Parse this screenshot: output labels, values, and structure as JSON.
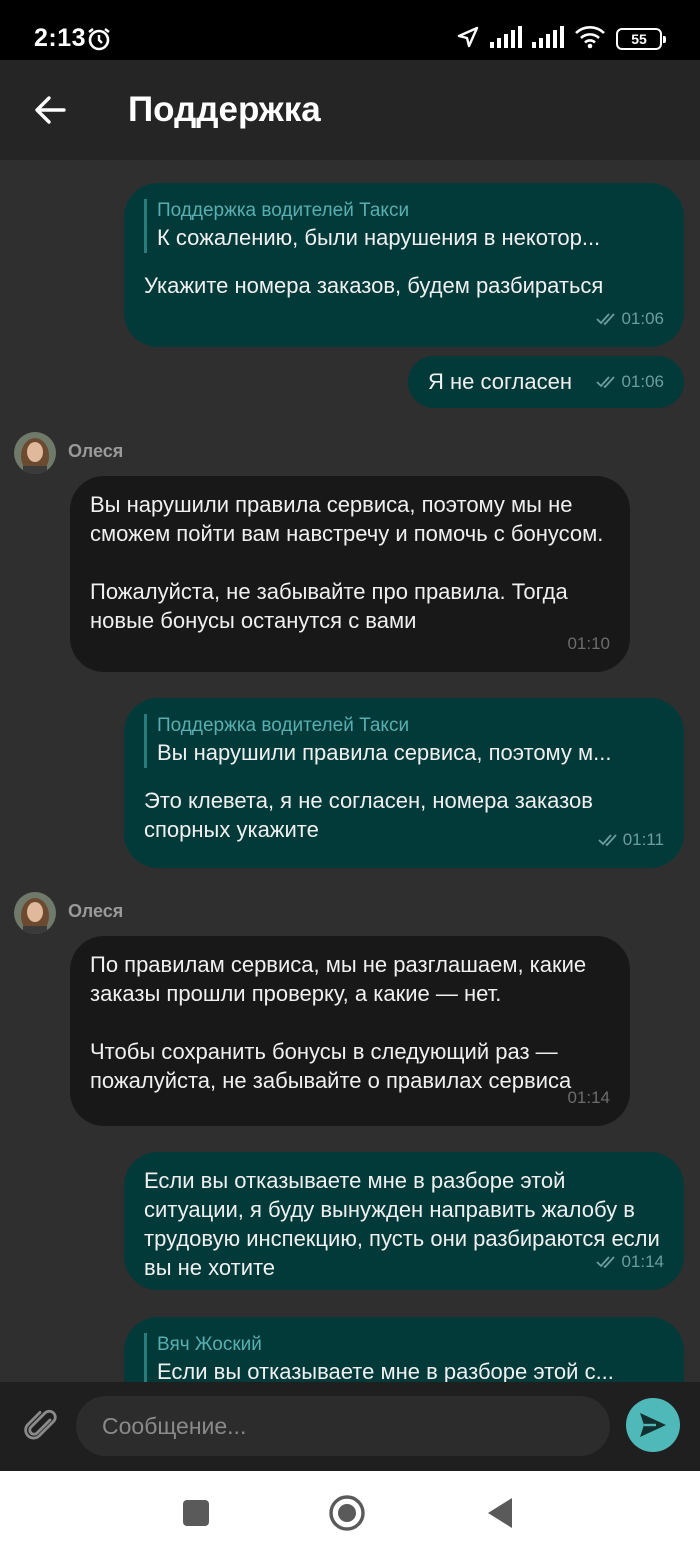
{
  "status_bar": {
    "time": "2:13",
    "battery": "55",
    "icons": [
      "alarm-icon",
      "location-icon",
      "signal-icon",
      "signal-icon",
      "wifi-icon",
      "battery-icon"
    ]
  },
  "header": {
    "title": "Поддержка",
    "back_icon": "arrow-left-icon"
  },
  "messages": [
    {
      "direction": "out",
      "quote_author": "Поддержка водителей Такси",
      "quote_text": "К сожалению, были нарушения в некотор...",
      "text": "Укажите номера заказов, будем разбираться",
      "time": "01:06",
      "status": "read"
    },
    {
      "direction": "out",
      "text": "Я не согласен",
      "time": "01:06",
      "status": "read"
    },
    {
      "direction": "in",
      "sender": "Олеся",
      "text": "Вы нарушили правила сервиса, поэтому мы не сможем пойти вам навстречу и помочь с бонусом.\n\nПожалуйста, не забывайте про правила. Тогда новые бонусы останутся с вами",
      "time": "01:10"
    },
    {
      "direction": "out",
      "quote_author": "Поддержка водителей Такси",
      "quote_text": "Вы нарушили правила сервиса, поэтому м...",
      "text": "Это клевета, я не согласен, номера заказов спорных укажите",
      "time": "01:11",
      "status": "read"
    },
    {
      "direction": "in",
      "sender": "Олеся",
      "text": "По правилам сервиса, мы не разглашаем, какие заказы прошли проверку, а какие — нет.\n\nЧтобы сохранить бонусы в следующий раз — пожалуйста, не забывайте о правилах сервиса",
      "time": "01:14"
    },
    {
      "direction": "out",
      "text": "Если вы отказываете мне в разборе этой ситуации, я буду вынужден направить жалобу в трудовую инспекцию, пусть они разбираются если вы не хотите",
      "time": "01:14",
      "status": "read"
    },
    {
      "direction": "out",
      "quote_author": "Вяч Жоский",
      "quote_text": "Если вы отказываете мне в разборе этой с..."
    }
  ],
  "composer": {
    "placeholder": "Сообщение...",
    "value": "",
    "attach_icon": "paperclip-icon",
    "send_icon": "send-icon",
    "send_color": "#4fb9b9"
  },
  "nav_bar": {
    "buttons": [
      "recents-square-icon",
      "home-circle-icon",
      "back-triangle-icon"
    ]
  },
  "colors": {
    "outgoing_bubble": "#023a3a",
    "incoming_bubble": "#181818",
    "background": "#2f2f2f",
    "accent": "#58aeb0"
  }
}
